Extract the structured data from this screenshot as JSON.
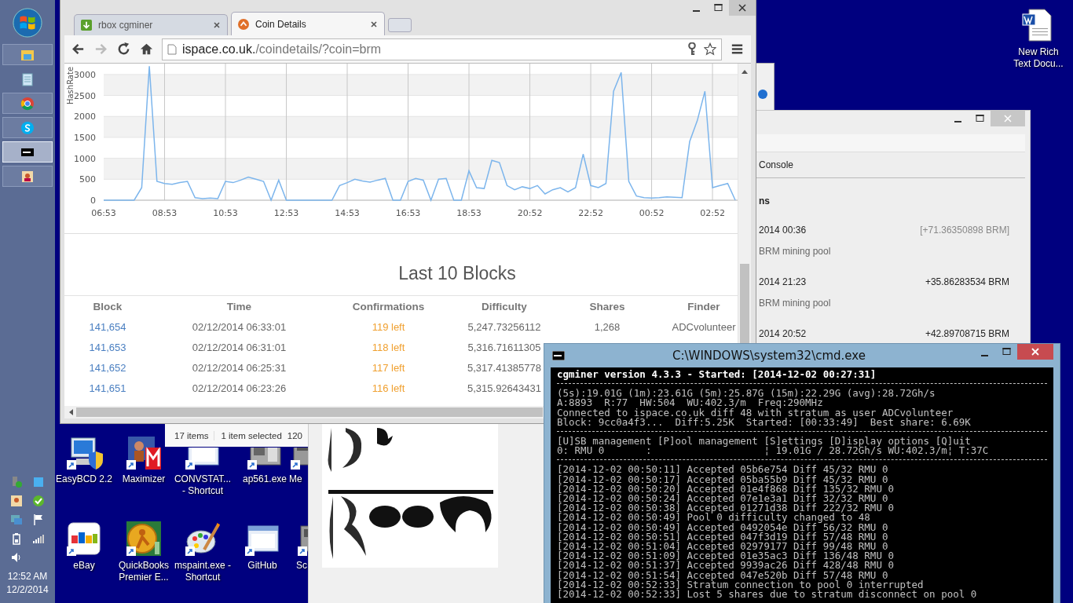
{
  "taskbar": {
    "buttons": [
      {
        "kind": "folder",
        "running": true,
        "selected": false
      },
      {
        "kind": "notepad",
        "running": false,
        "selected": false
      },
      {
        "kind": "chrome",
        "running": true,
        "selected": false
      },
      {
        "kind": "skype",
        "running": true,
        "selected": false
      },
      {
        "kind": "console",
        "running": true,
        "selected": true
      },
      {
        "kind": "app",
        "running": true,
        "selected": false
      }
    ],
    "tray": {
      "time": "12:52 AM",
      "date": "12/2/2014"
    }
  },
  "desktop_icons": [
    {
      "kind": "easybcd",
      "label": "EasyBCD 2.2"
    },
    {
      "kind": "maximizer",
      "label": "Maximizer"
    },
    {
      "kind": "window",
      "label": "CONVSTAT... - Shortcut"
    },
    {
      "kind": "machine",
      "label": "ap561.exe"
    },
    {
      "kind": "generic",
      "label": "Me"
    },
    {
      "kind": "ebay",
      "label": "eBay"
    },
    {
      "kind": "coin",
      "label": "QuickBooks Premier E..."
    },
    {
      "kind": "palette",
      "label": "mspaint.exe - Shortcut"
    },
    {
      "kind": "window",
      "label": "GitHub"
    },
    {
      "kind": "generic",
      "label": "Sc"
    },
    {
      "kind": "document",
      "label": "New Rich Text Docu..."
    }
  ],
  "right_window": {
    "tab": "Console",
    "heading": "ns",
    "transactions": [
      {
        "date": "2014 00:36",
        "amount": "[+71.36350898 BRM]",
        "pending": true,
        "note": "BRM mining pool"
      },
      {
        "date": "2014 21:23",
        "amount": "+35.86283534 BRM",
        "pending": false,
        "note": "BRM mining pool"
      },
      {
        "date": "2014 20:52",
        "amount": "+42.89708715 BRM",
        "pending": false
      }
    ]
  },
  "explorer_status": {
    "items": "17 items",
    "selection": "1 item selected",
    "size": "120"
  },
  "browser": {
    "tabs": [
      {
        "title": "rbox cgminer",
        "kind": "download",
        "selected": false
      },
      {
        "title": "Coin Details",
        "kind": "coin",
        "selected": true
      }
    ],
    "toolbar": {
      "forward_disabled": true,
      "url_host": "ispace.co.uk.",
      "url_path": "/coindetails/?coin=brm"
    },
    "page": {
      "chart_data": {
        "type": "line",
        "ylabel": "HashRate",
        "categories": [
          "06:53",
          null,
          null,
          null,
          null,
          null,
          null,
          null,
          "08:53",
          null,
          null,
          null,
          null,
          null,
          null,
          null,
          "10:53",
          null,
          null,
          null,
          null,
          null,
          null,
          null,
          "12:53",
          null,
          null,
          null,
          null,
          null,
          null,
          null,
          "14:53",
          null,
          null,
          null,
          null,
          null,
          null,
          null,
          "16:53",
          null,
          null,
          null,
          null,
          null,
          null,
          null,
          "18:53",
          null,
          null,
          null,
          null,
          null,
          null,
          null,
          "20:52",
          null,
          null,
          null,
          null,
          null,
          null,
          null,
          "22:52",
          null,
          null,
          null,
          null,
          null,
          null,
          null,
          "00:52",
          null,
          null,
          null,
          null,
          null,
          null,
          null,
          "02:52",
          null,
          null,
          null
        ],
        "values": [
          0,
          0,
          0,
          0,
          0,
          300,
          3200,
          450,
          400,
          380,
          420,
          450,
          60,
          40,
          50,
          40,
          450,
          420,
          480,
          550,
          500,
          450,
          0,
          480,
          0,
          0,
          0,
          0,
          0,
          0,
          0,
          350,
          420,
          500,
          460,
          430,
          480,
          520,
          0,
          0,
          450,
          520,
          480,
          0,
          500,
          520,
          0,
          0,
          700,
          300,
          280,
          950,
          900,
          350,
          250,
          320,
          280,
          350,
          150,
          250,
          300,
          200,
          300,
          1100,
          350,
          300,
          400,
          2600,
          3050,
          450,
          100,
          60,
          50,
          60,
          80,
          70,
          60,
          1400,
          1900,
          2600,
          300,
          350,
          400,
          0
        ],
        "ylim": [
          0,
          3260
        ],
        "grid": true,
        "yticks": [
          0,
          500,
          1000,
          1500,
          2000,
          2500,
          3000
        ]
      },
      "heading": "Last 10 Blocks",
      "columns": [
        "Block",
        "Time",
        "Confirmations",
        "Difficulty",
        "Shares",
        "Finder"
      ],
      "rows": [
        {
          "block": "141,654",
          "time": "02/12/2014 06:33:01",
          "confirmations": "119 left",
          "difficulty": "5,247.73256112",
          "shares": "1,268",
          "finder": "ADCvolunteer"
        },
        {
          "block": "141,653",
          "time": "02/12/2014 06:31:01",
          "confirmations": "118 left",
          "difficulty": "5,316.71611305"
        },
        {
          "block": "141,652",
          "time": "02/12/2014 06:25:31",
          "confirmations": "117 left",
          "difficulty": "5,317.41385778"
        },
        {
          "block": "141,651",
          "time": "02/12/2014 06:23:26",
          "confirmations": "116 left",
          "difficulty": "5,315.92643431"
        }
      ]
    }
  },
  "console": {
    "title": "C:\\WINDOWS\\system32\\cmd.exe",
    "header": "cgminer version 4.3.3 - Started: [2014-12-02 00:27:31]",
    "stats": [
      "(5s):19.01G (1m):23.61G (5m):25.87G (15m):22.29G (avg):28.72Gh/s",
      "A:8893  R:77  HW:504  WU:402.3/m  Freq:290MHz",
      "Connected to ispace.co.uk diff 48 with stratum as user ADCvolunteer",
      "Block: 9cc0a4f3...  Diff:5.25K  Started: [00:33:49]  Best share: 6.69K"
    ],
    "menu": [
      "[U]SB management [P]ool management [S]ettings [D]isplay options [Q]uit",
      "0: RMU 0       :                   ¦ 19.01G / 28.72Gh/s WU:402.3/m¦ T:37C"
    ],
    "log": [
      "[2014-12-02 00:50:11] Accepted 05b6e754 Diff 45/32 RMU 0",
      "[2014-12-02 00:50:17] Accepted 05ba55b9 Diff 45/32 RMU 0",
      "[2014-12-02 00:50:20] Accepted 01e4f868 Diff 135/32 RMU 0",
      "[2014-12-02 00:50:24] Accepted 07e1e3a1 Diff 32/32 RMU 0",
      "[2014-12-02 00:50:38] Accepted 01271d38 Diff 222/32 RMU 0",
      "[2014-12-02 00:50:49] Pool 0 difficulty changed to 48",
      "[2014-12-02 00:50:49] Accepted 0492054e Diff 56/32 RMU 0",
      "[2014-12-02 00:50:51] Accepted 047f3d19 Diff 57/48 RMU 0",
      "[2014-12-02 00:51:04] Accepted 02979177 Diff 99/48 RMU 0",
      "[2014-12-02 00:51:09] Accepted 01e35ac3 Diff 136/48 RMU 0",
      "[2014-12-02 00:51:37] Accepted 9939ac26 Diff 428/48 RMU 0",
      "[2014-12-02 00:51:54] Accepted 047e520b Diff 57/48 RMU 0",
      "[2014-12-02 00:52:33] Stratum connection to pool 0 interrupted",
      "[2014-12-02 00:52:33] Lost 5 shares due to stratum disconnect on pool 0"
    ]
  }
}
